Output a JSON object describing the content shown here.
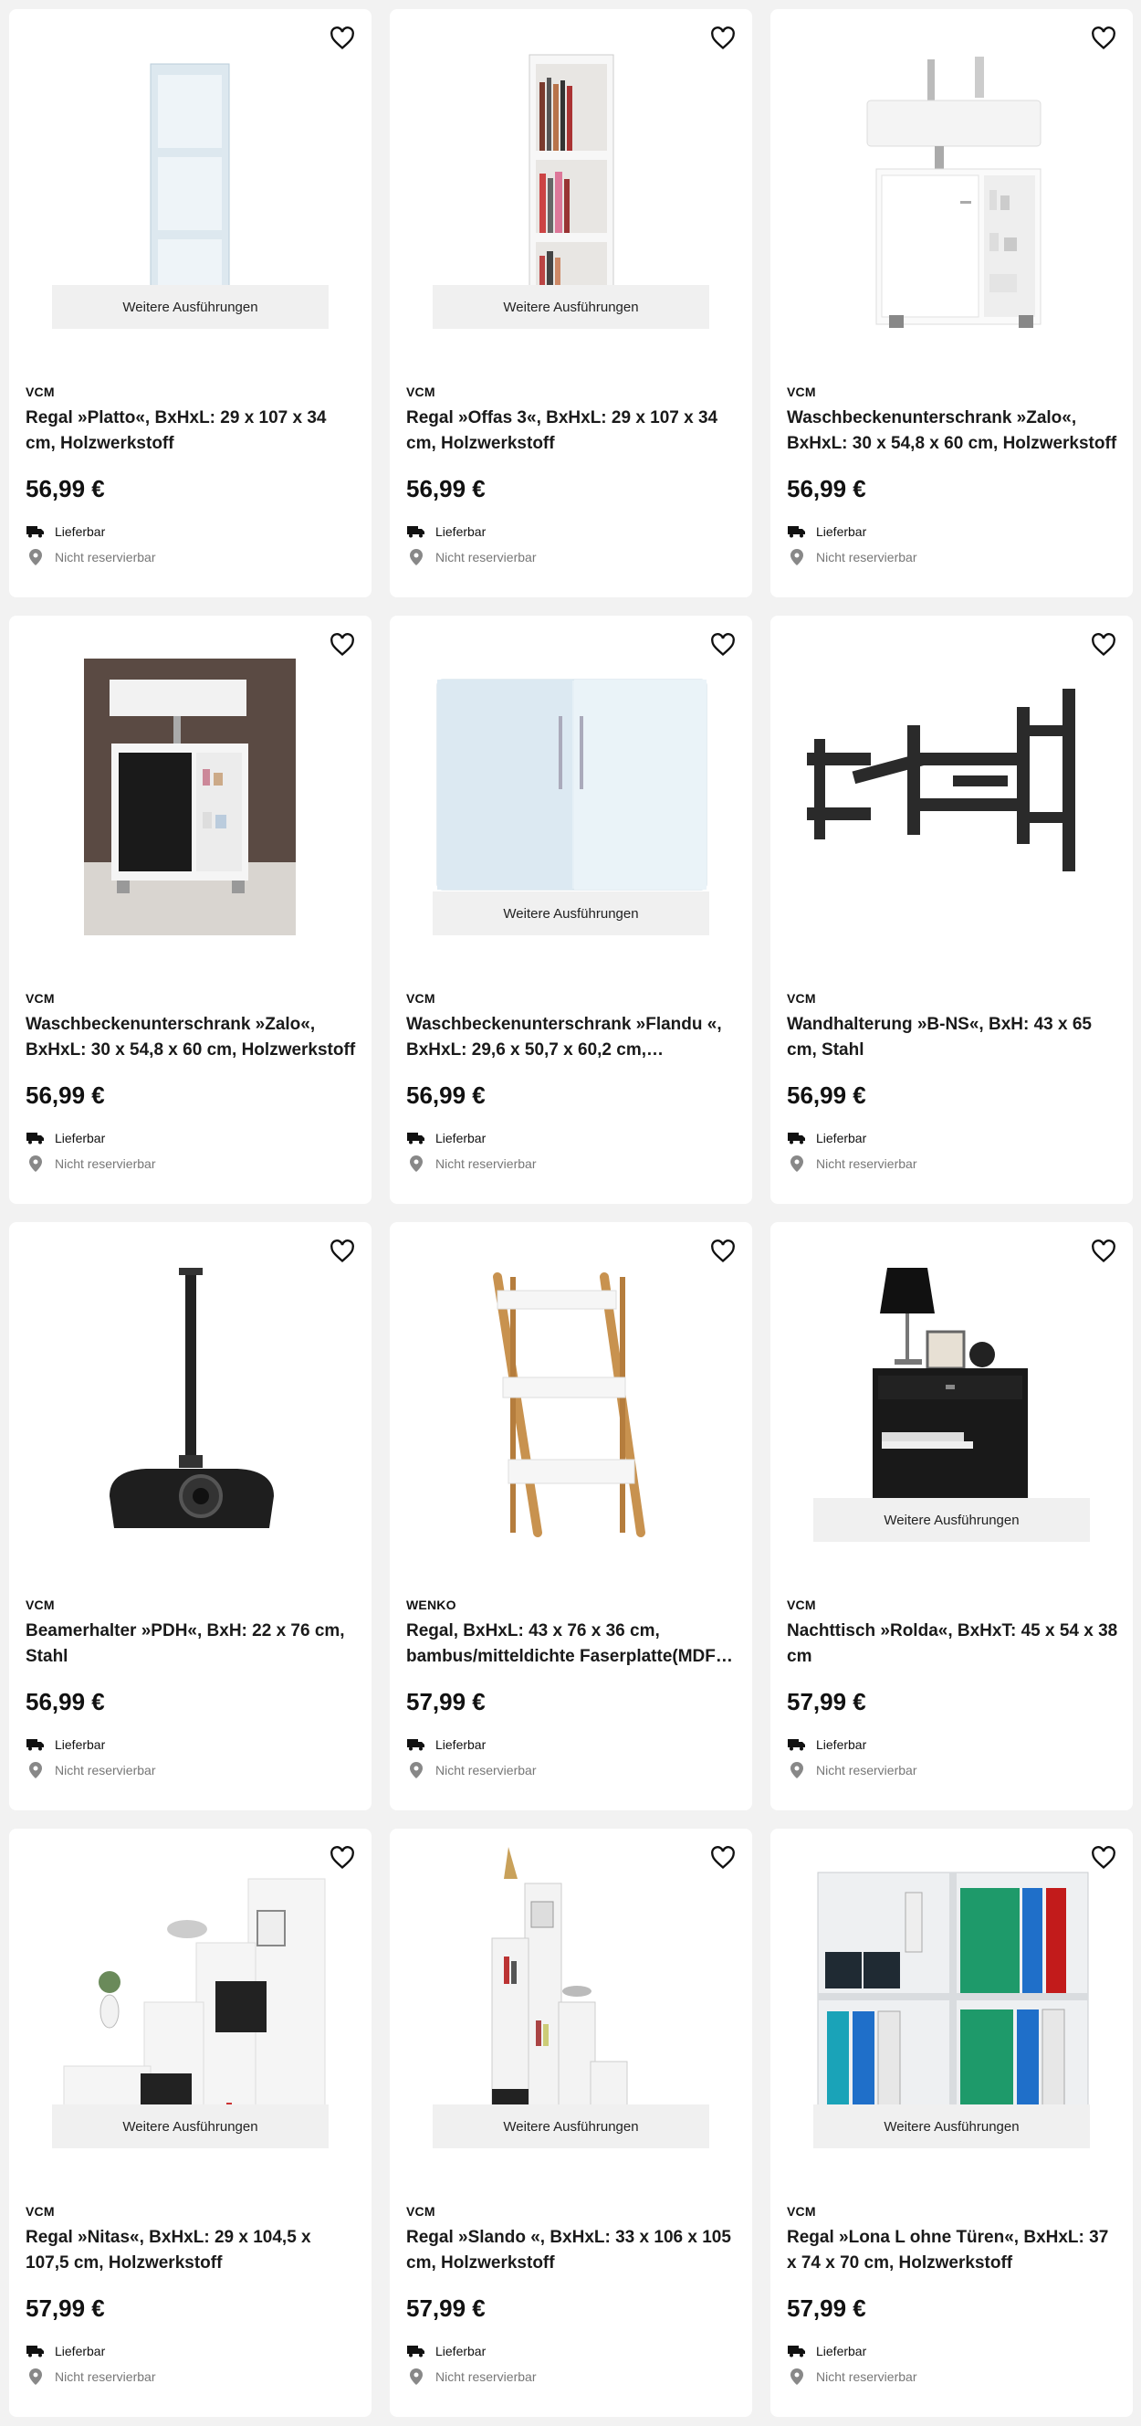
{
  "labels": {
    "variants": "Weitere Ausführungen",
    "delivery": "Lieferbar",
    "reserve": "Nicht reservierbar"
  },
  "icons": {
    "wishlist": "heart-icon",
    "delivery": "truck-icon",
    "reserve": "location-pin-icon"
  },
  "products": [
    {
      "brand": "VCM",
      "title": "Regal »Platto«, BxHxL: 29 x 107 x 34 cm, Holzwerkstoff",
      "price": "56,99 €",
      "variants": true
    },
    {
      "brand": "VCM",
      "title": "Regal »Offas 3«, BxHxL: 29 x 107 x 34 cm, Holzwerkstoff",
      "price": "56,99 €",
      "variants": true
    },
    {
      "brand": "VCM",
      "title": "Waschbeckenunterschrank »Zalo«, BxHxL: 30 x 54,8 x 60 cm, Holzwerkstoff",
      "price": "56,99 €",
      "variants": false
    },
    {
      "brand": "VCM",
      "title": "Waschbeckenunterschrank »Zalo«, BxHxL: 30 x 54,8 x 60 cm, Holzwerkstoff",
      "price": "56,99 €",
      "variants": false
    },
    {
      "brand": "VCM",
      "title": "Waschbeckenunterschrank »Flandu «, BxHxL: 29,6 x 50,7 x 60,2 cm,…",
      "price": "56,99 €",
      "variants": true
    },
    {
      "brand": "VCM",
      "title": "Wandhalterung »B-NS«, BxH: 43 x 65 cm, Stahl",
      "price": "56,99 €",
      "variants": false
    },
    {
      "brand": "VCM",
      "title": "Beamerhalter »PDH«, BxH: 22 x 76 cm, Stahl",
      "price": "56,99 €",
      "variants": false
    },
    {
      "brand": "WENKO",
      "title": "Regal, BxHxL: 43 x 76 x 36 cm, bambus/mitteldichte Faserplatte(MDF…",
      "price": "57,99 €",
      "variants": false
    },
    {
      "brand": "VCM",
      "title": "Nachttisch »Rolda«, BxHxT: 45 x 54 x 38 cm",
      "price": "57,99 €",
      "variants": true
    },
    {
      "brand": "VCM",
      "title": "Regal »Nitas«, BxHxL: 29 x 104,5 x 107,5 cm, Holzwerkstoff",
      "price": "57,99 €",
      "variants": true
    },
    {
      "brand": "VCM",
      "title": "Regal »Slando «, BxHxL: 33 x 106 x 105 cm, Holzwerkstoff",
      "price": "57,99 €",
      "variants": true
    },
    {
      "brand": "VCM",
      "title": "Regal »Lona L ohne Türen«, BxHxL: 37 x 74 x 70 cm, Holzwerkstoff",
      "price": "57,99 €",
      "variants": true
    }
  ]
}
